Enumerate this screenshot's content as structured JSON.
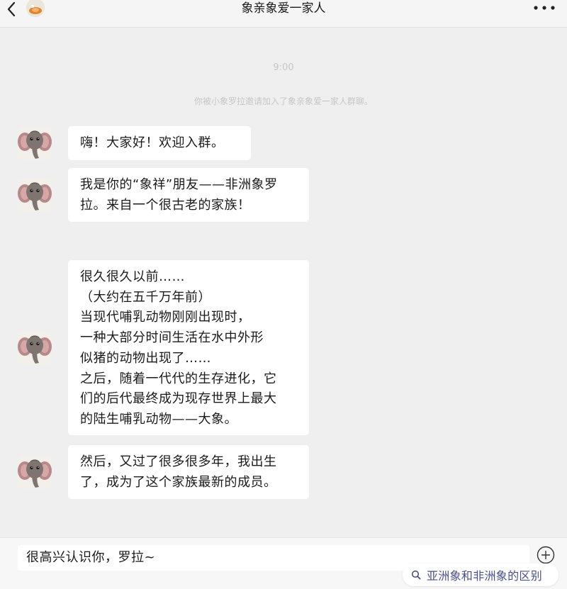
{
  "header": {
    "title": "象亲象爱一家人",
    "back_icon": "chevron-left-icon",
    "more_icon": "more-dots-icon"
  },
  "chat": {
    "time": "9:00",
    "system_notice": "你被小象罗拉邀请加入了象亲象爱一家人群聊。",
    "messages": [
      {
        "sender_avatar": "elephant-avatar",
        "text": "嗨！大家好！欢迎入群。"
      },
      {
        "sender_avatar": "elephant-avatar",
        "text": "我是你的“象祥”朋友——非洲象罗\n拉。来自一个很古老的家族！"
      },
      {
        "sender_avatar": "elephant-avatar",
        "text": "很久很久以前……\n（大约在五千万年前）\n当现代哺乳动物刚刚出现时，\n一种大部分时间生活在水中外形\n似猪的动物出现了……\n之后，随着一代代的生存进化，它\n们的后代最终成为现存世界上最大\n的陆生哺乳动物——大象。"
      },
      {
        "sender_avatar": "elephant-avatar",
        "text": "然后，又过了很多很多年，我出生\n了，成为了这个家族最新的成员。"
      }
    ]
  },
  "composer": {
    "input_value": "很高兴认识你，罗拉~",
    "plus_icon": "plus-circle-icon"
  },
  "suggestion": {
    "icon": "search-icon",
    "label": "亚洲象和非洲象的区别"
  },
  "colors": {
    "background": "#efefef",
    "bubble": "#ffffff",
    "suggestion_text": "#4a4f8c"
  }
}
